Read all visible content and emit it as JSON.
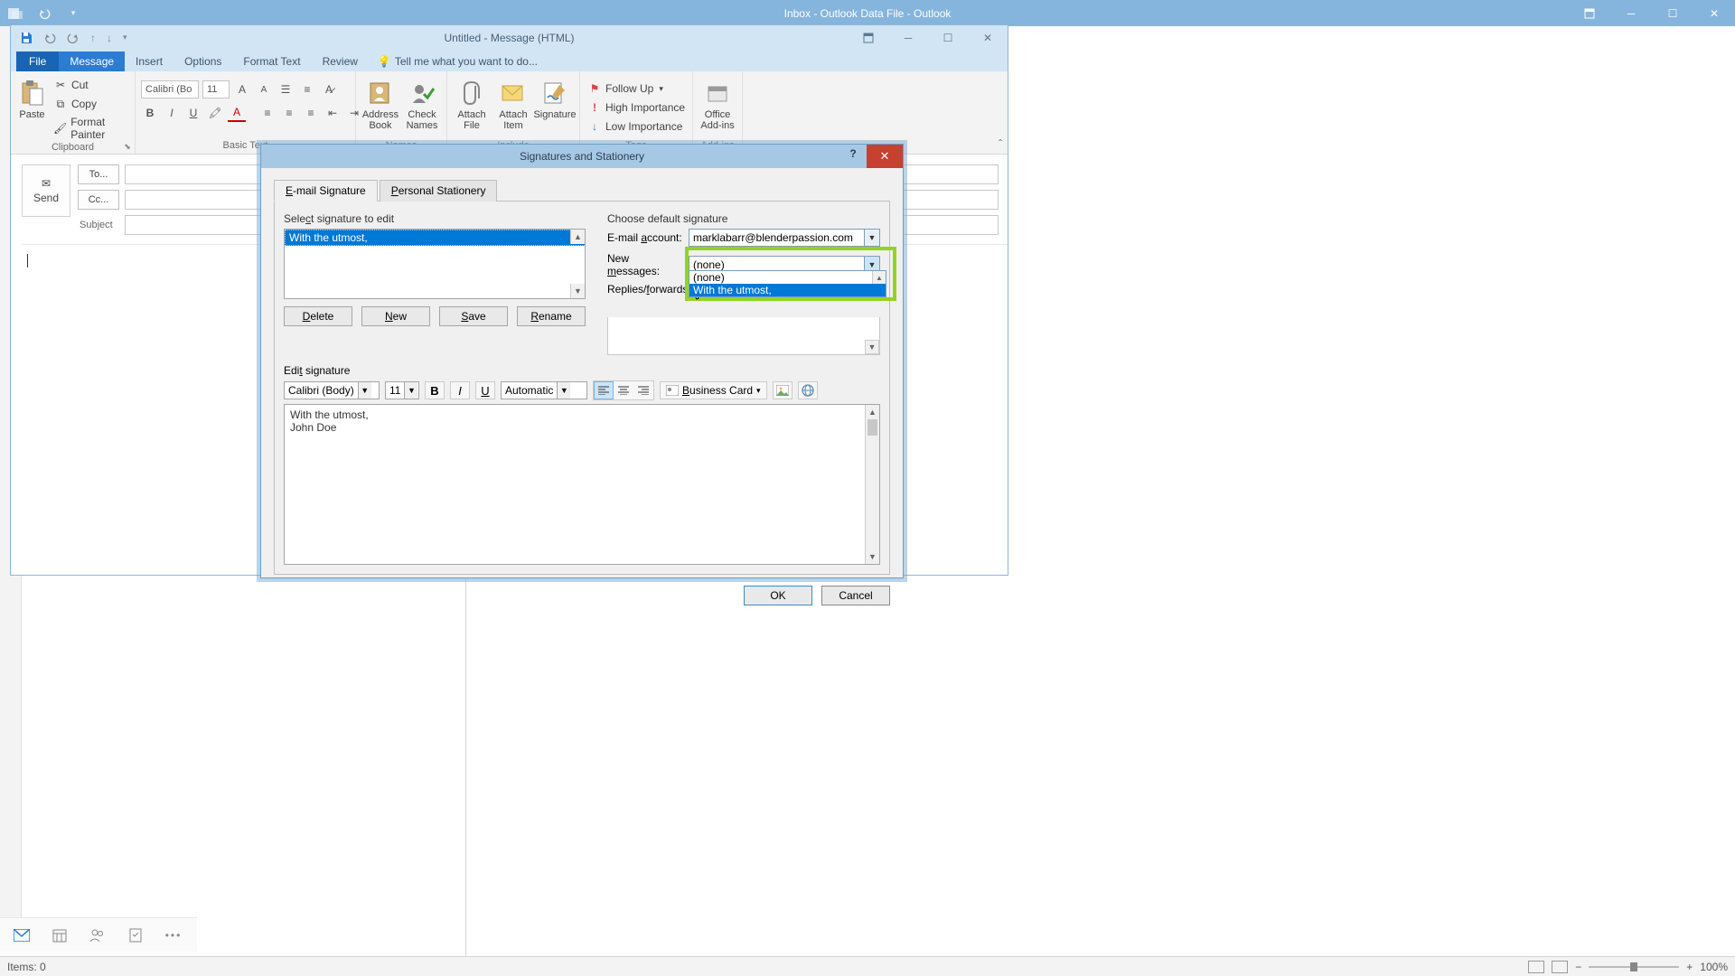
{
  "main_window": {
    "title": "Inbox - Outlook Data File - Outlook",
    "status_items": "Items: 0",
    "zoom": "100%"
  },
  "message_window": {
    "title": "Untitled - Message (HTML)",
    "tabs": {
      "file": "File",
      "message": "Message",
      "insert": "Insert",
      "options": "Options",
      "format_text": "Format Text",
      "review": "Review",
      "tellme": "Tell me what you want to do..."
    },
    "ribbon": {
      "clipboard": {
        "label": "Clipboard",
        "paste": "Paste",
        "cut": "Cut",
        "copy": "Copy",
        "format_painter": "Format Painter"
      },
      "basic_text": {
        "label": "Basic Text",
        "font": "Calibri (Bo",
        "size": "11"
      },
      "names": {
        "label": "Names",
        "address_book": "Address\nBook",
        "check_names": "Check\nNames"
      },
      "include": {
        "label": "Include",
        "attach_file": "Attach\nFile",
        "attach_item": "Attach\nItem",
        "signature": "Signature"
      },
      "tags": {
        "label": "Tags",
        "follow_up": "Follow Up",
        "high": "High Importance",
        "low": "Low Importance"
      },
      "addins": {
        "label": "Add-ins",
        "office": "Office\nAdd-ins"
      }
    },
    "compose": {
      "send": "Send",
      "to": "To...",
      "cc": "Cc...",
      "subject": "Subject"
    }
  },
  "signatures_dialog": {
    "title": "Signatures and Stationery",
    "tabs": {
      "email_sig": "E-mail Signature",
      "personal_stat": "Personal Stationery"
    },
    "select_label": "Select signature to edit",
    "signature_list_item": "With the utmost,",
    "buttons": {
      "delete": "Delete",
      "new": "New",
      "save": "Save",
      "rename": "Rename"
    },
    "default_label": "Choose default signature",
    "fields": {
      "email_account_label": "E-mail account:",
      "email_account_value": "marklabarr@blenderpassion.com",
      "new_messages_label": "New messages:",
      "new_messages_value": "(none)",
      "replies_label": "Replies/forwards:"
    },
    "dropdown": {
      "opt_none": "(none)",
      "opt_sig": "With the utmost,"
    },
    "edit_label": "Edit signature",
    "edit_toolbar": {
      "font": "Calibri (Body)",
      "size": "11",
      "color": "Automatic",
      "business_card": "Business Card"
    },
    "edit_content_line1": "With the utmost,",
    "edit_content_line2": "John Doe",
    "dlg_buttons": {
      "ok": "OK",
      "cancel": "Cancel"
    }
  }
}
